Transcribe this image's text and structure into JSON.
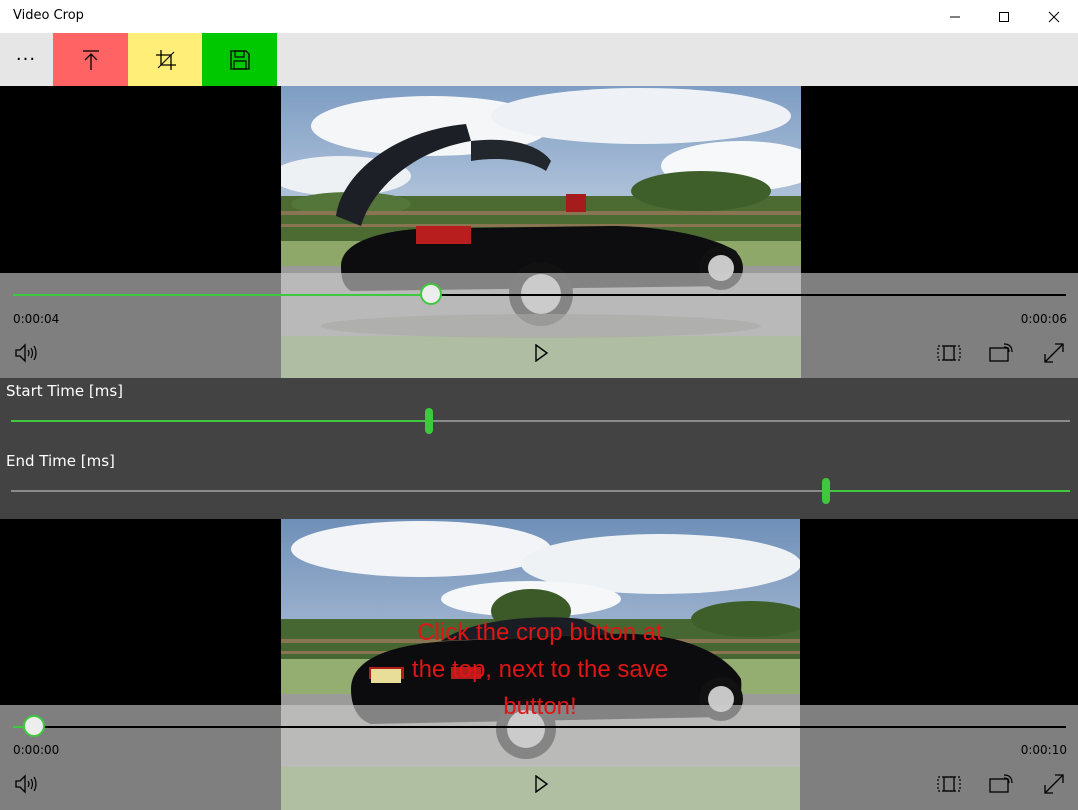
{
  "window": {
    "title": "Video Crop"
  },
  "command_bar": {
    "more_label": "···",
    "buttons": [
      {
        "name": "open",
        "icon": "upload-icon",
        "color": "#ff6363"
      },
      {
        "name": "crop",
        "icon": "crop-icon",
        "color": "#ffee77"
      },
      {
        "name": "save",
        "icon": "save-icon",
        "color": "#00c800"
      }
    ]
  },
  "source_player": {
    "position_fraction": 0.397,
    "current_time": "0:00:04",
    "remaining_time": "0:00:06"
  },
  "trim": {
    "start_label": "Start Time [ms]",
    "start_fraction": 0.395,
    "end_label": "End Time  [ms]",
    "end_fraction": 0.77
  },
  "preview_player": {
    "position_fraction": 0.02,
    "current_time": "0:00:00",
    "remaining_time": "0:00:10",
    "overlay_message": "Click the crop button at the top, next to the save button!"
  },
  "colors": {
    "accent": "#3ec83e",
    "panel": "#434343",
    "message": "#e01515"
  }
}
